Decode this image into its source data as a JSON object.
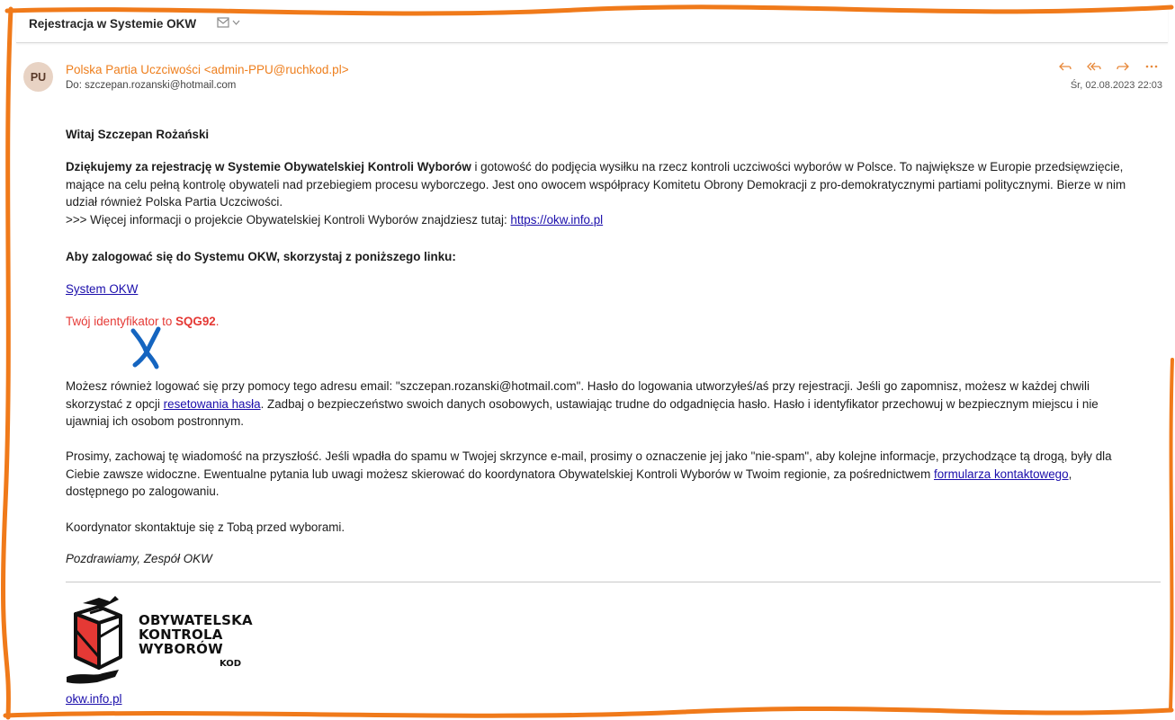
{
  "email": {
    "subject": "Rejestracja w Systemie OKW",
    "sender": {
      "initials": "PU",
      "display": "Polska Partia Uczciwości <admin-PPU@ruchkod.pl>",
      "to_label": "Do:",
      "to_address": "szczepan.rozanski@hotmail.com",
      "date": "Śr, 02.08.2023 22:03"
    },
    "icons": {
      "subject": [
        "mail-status-icon",
        "chevron-down-icon"
      ],
      "actions": [
        "reply-icon",
        "reply-all-icon",
        "forward-icon",
        "more-icon"
      ]
    },
    "colors": {
      "sender": "#ee7f1e",
      "identifier": "#e53935",
      "link": "#1a0dab",
      "annotation": "#f07a1a",
      "mark": "#1565c0"
    }
  },
  "body": {
    "greeting": "Witaj Szczepan Rożański",
    "para1": {
      "bold": "Dziękujemy za rejestrację w Systemie Obywatelskiej Kontroli Wyborów",
      "text": " i gotowość do podjęcia wysiłku na rzecz kontroli uczciwości wyborów w Polsce. To największe w Europie przedsięwzięcie, mające na celu pełną kontrolę obywateli nad przebiegiem procesu wyborczego. Jest ono owocem współpracy Komitetu Obrony Demokracji z pro-demokratycznymi partiami politycznymi. Bierze w nim udział również Polska Partia Uczciwości.",
      "more_prefix": ">>> Więcej informacji o projekcie Obywatelskiej Kontroli Wyborów znajdziesz tutaj: ",
      "more_link": "https://okw.info.pl"
    },
    "login_title": "Aby zalogować się do Systemu OKW, skorzystaj z poniższego linku:",
    "system_link": "System OKW",
    "identifier_prefix": "Twój identyfikator to ",
    "identifier": "SQG92",
    "identifier_suffix": ".",
    "para2": {
      "before": "Możesz również logować się przy pomocy tego adresu email: \"szczepan.rozanski@hotmail.com\". Hasło do logowania utworzyłeś/aś przy rejestracji. Jeśli go zapomnisz, możesz w każdej chwili skorzystać z opcji ",
      "link": "resetowania hasła",
      "after": ". Zadbaj o bezpieczeństwo swoich danych osobowych, ustawiając trudne do odgadnięcia hasło. Hasło i identyfikator przechowuj w bezpiecznym miejscu i nie ujawniaj ich osobom postronnym."
    },
    "para3": {
      "before": "Prosimy, zachowaj tę wiadomość na przyszłość. Jeśli wpadła do spamu w Twojej skrzynce e-mail, prosimy o oznaczenie jej jako \"nie-spam\", aby kolejne informacje, przychodzące tą drogą, były dla Ciebie zawsze widoczne. Ewentualne pytania lub uwagi możesz skierować do koordynatora Obywatelskiej Kontroli Wyborów w Twoim regionie, za pośrednictwem ",
      "link": "formularza kontaktowego",
      "after": ", dostępnego po zalogowaniu."
    },
    "coordinator": "Koordynator skontaktuje się z Tobą przed wyborami.",
    "regards": "Pozdrawiamy, Zespół OKW"
  },
  "footer": {
    "logo_lines": [
      "OBYWATELSKA",
      "KONTROLA",
      "WYBORÓW"
    ],
    "logo_kod": "KOD",
    "site_link": "okw.info.pl"
  }
}
